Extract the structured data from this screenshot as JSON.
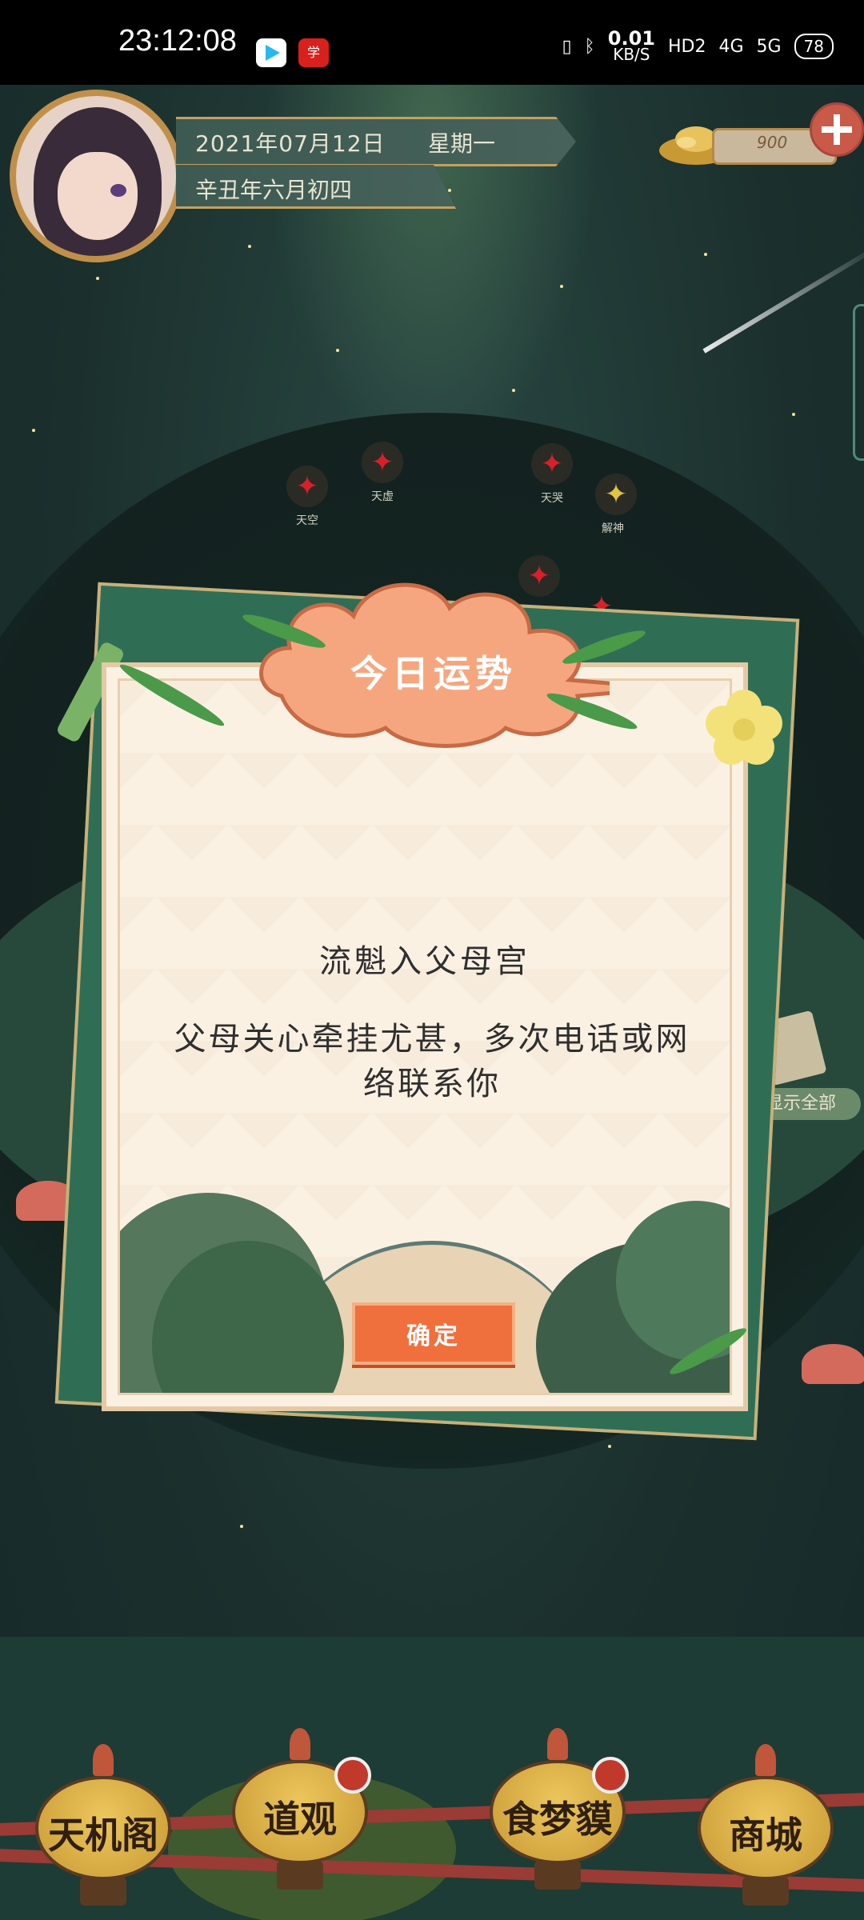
{
  "status_bar": {
    "time": "23:12:08",
    "net_speed_value": "0.01",
    "net_speed_unit": "KB/S",
    "hd_label": "HD2",
    "signal_1": "4G",
    "signal_2": "5G",
    "battery": "78"
  },
  "header": {
    "date": "2021年07月12日",
    "weekday": "星期一",
    "lunar_date": "辛丑年六月初四",
    "coins": "900"
  },
  "markers": [
    {
      "label": "天空",
      "color": "#d9202a"
    },
    {
      "label": "天虚",
      "color": "#d9202a"
    },
    {
      "label": "天哭",
      "color": "#d9202a"
    },
    {
      "label": "解神",
      "color": "#e0c640"
    }
  ],
  "dialog": {
    "title": "今日运势",
    "line1": "流魁入父母宫",
    "line2": "父母关心牵挂尤甚，多次电话或网络联系你",
    "confirm_label": "确定"
  },
  "side": {
    "show_all_label": "显示全部"
  },
  "bottom_nav": [
    {
      "label": "天机阁",
      "badge": false
    },
    {
      "label": "道观",
      "badge": true
    },
    {
      "label": "食梦貘",
      "badge": true
    },
    {
      "label": "商城",
      "badge": false
    }
  ],
  "colors": {
    "accent_orange": "#f0703d",
    "panel_cream": "#fbf1e3",
    "gold": "#c99a34",
    "badge_red": "#c0392b"
  }
}
